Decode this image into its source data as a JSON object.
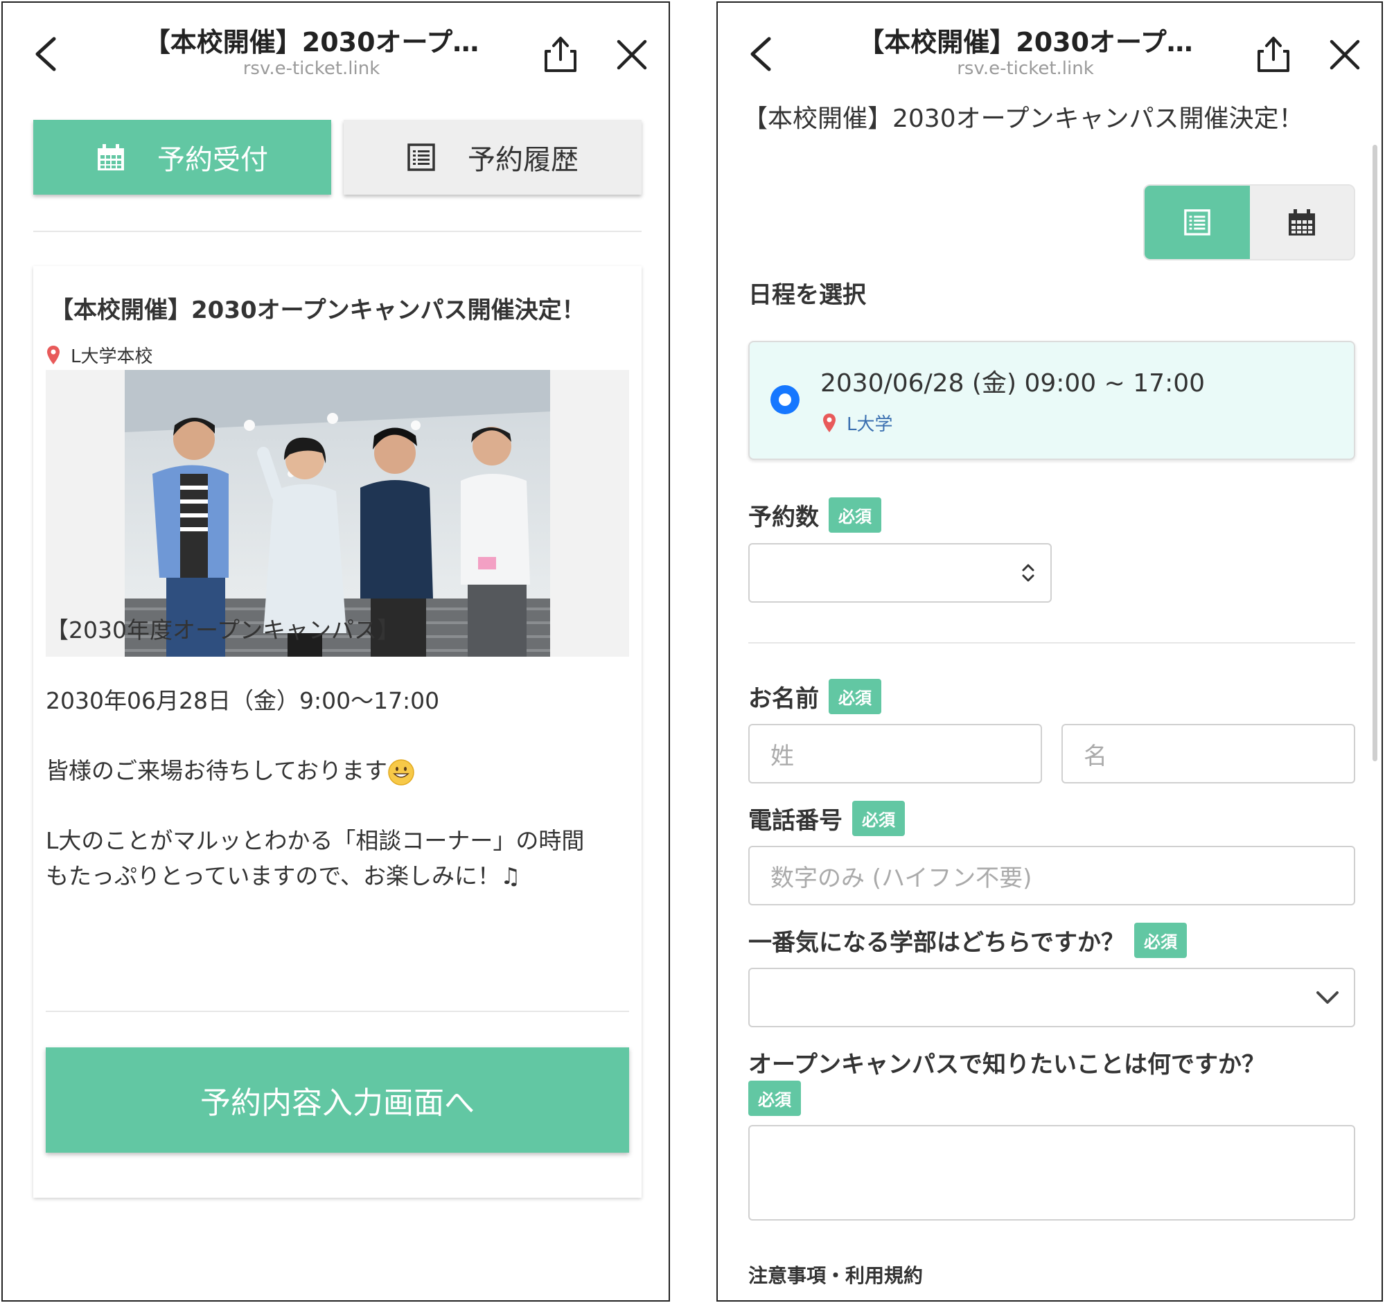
{
  "left": {
    "topbar": {
      "title": "【本校開催】2030オープ…",
      "url": "rsv.e-ticket.link"
    },
    "tabs": {
      "reserve": "予約受付",
      "history": "予約履歴"
    },
    "event": {
      "title": "【本校開催】2030オープンキャンパス開催決定！",
      "location": "L大学本校",
      "desc_line1": "【2030年度オープンキャンパス】",
      "desc_line2": "2030年06月28日（金）9:00〜17:00",
      "desc_line3": "皆様のご来場お待ちしております",
      "desc_line4": "L大のことがマルッとわかる「相談コーナー」の時間",
      "desc_line5": "もたっぷりとっていますので、お楽しみに！♫"
    },
    "cta": "予約内容入力画面へ"
  },
  "right": {
    "topbar": {
      "title": "【本校開催】2030オープ…",
      "url": "rsv.e-ticket.link"
    },
    "event_title": "【本校開催】2030オープンキャンパス開催決定！",
    "schedule_label": "日程を選択",
    "schedule": {
      "datetime": "2030/06/28 (金) 09:00 ~ 17:00",
      "location": "L大学"
    },
    "required": "必須",
    "quantity_label": "予約数",
    "name_label": "お名前",
    "name_last_placeholder": "姓",
    "name_first_placeholder": "名",
    "phone_label": "電話番号",
    "phone_placeholder": "数字のみ (ハイフン不要)",
    "faculty_label": "一番気になる学部はどちらですか？",
    "question_label": "オープンキャンパスで知りたいことは何ですか？",
    "terms_label": "注意事項・利用規約"
  },
  "colors": {
    "accent": "#62c7a3",
    "radio": "#1677ff",
    "pin": "#e85a5a",
    "schedule_bg": "#eafaf8"
  },
  "icons": [
    "back-arrow-icon",
    "share-icon",
    "close-icon",
    "calendar-icon",
    "list-icon",
    "map-pin-icon",
    "grin-emoji-icon",
    "updown-chevron-icon",
    "chevron-down-icon"
  ]
}
